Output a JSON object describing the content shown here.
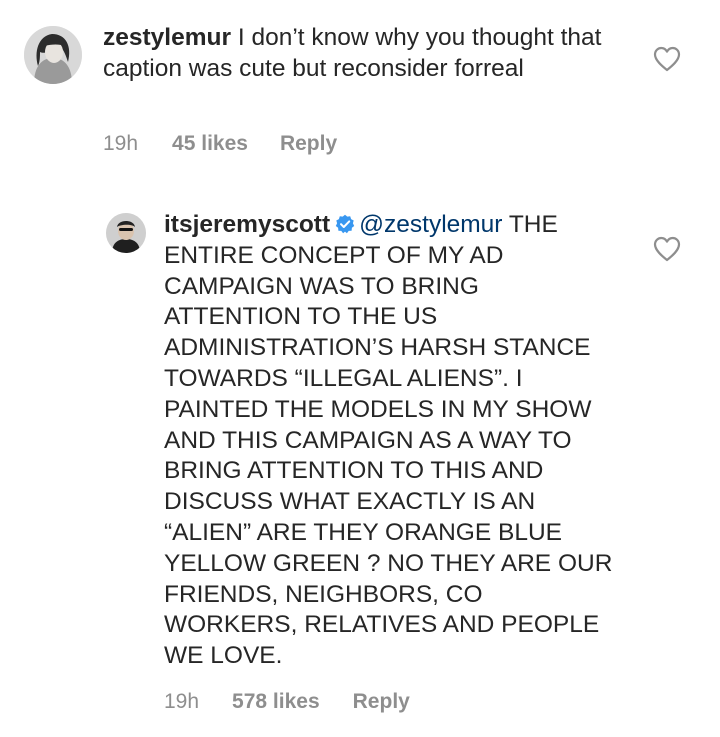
{
  "comments": [
    {
      "username": "zestylemur",
      "text": "I don’t know why you thought that caption was cute but reconsider forreal",
      "time": "19h",
      "likes": "45 likes",
      "reply_label": "Reply",
      "avatar_icon": "profile-photo-woman",
      "like_icon": "heart-outline-icon"
    },
    {
      "username": "itsjeremyscott",
      "verified": true,
      "mention": "@zestylemur",
      "text": "THE ENTIRE CONCEPT OF MY AD CAMPAIGN WAS TO BRING ATTENTION TO THE US ADMINISTRATION’S HARSH STANCE TOWARDS “ILLEGAL ALIENS”. I PAINTED THE MODELS IN MY SHOW AND THIS CAMPAIGN AS A WAY TO BRING ATTENTION TO THIS AND DISCUSS WHAT EXACTLY IS AN “ALIEN” ARE THEY ORANGE BLUE YELLOW GREEN ? NO THEY ARE OUR FRIENDS, NEIGHBORS, CO WORKERS, RELATIVES AND PEOPLE WE LOVE.",
      "time": "19h",
      "likes": "578 likes",
      "reply_label": "Reply",
      "avatar_icon": "profile-photo-man",
      "verified_icon": "verified-badge-icon",
      "like_icon": "heart-outline-icon"
    }
  ],
  "colors": {
    "text": "#262626",
    "mention": "#00376b",
    "meta": "#8e8e8e",
    "verified": "#3897f0"
  }
}
